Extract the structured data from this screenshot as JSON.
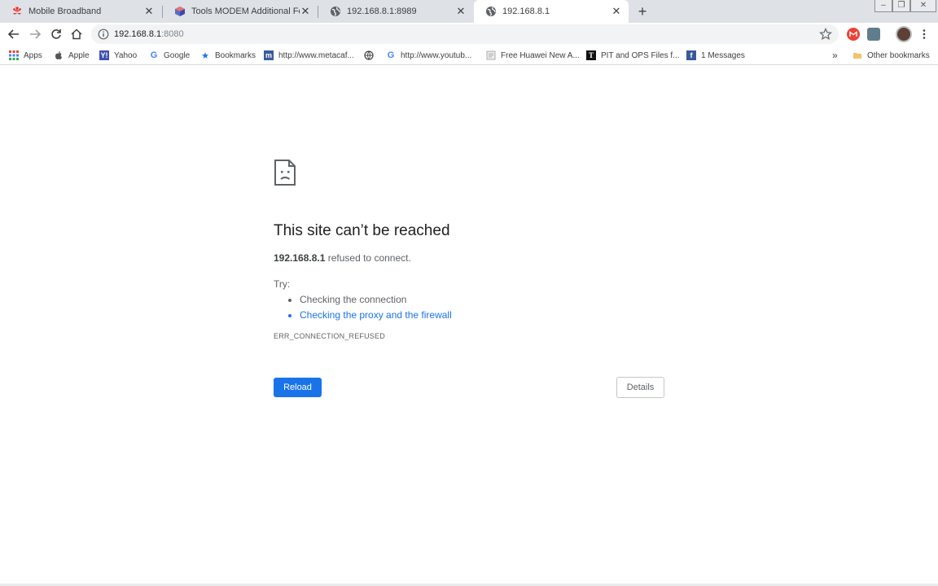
{
  "tabs": [
    {
      "title": "Mobile Broadband",
      "favicon": "huawei-logo-icon"
    },
    {
      "title": "Tools MODEM Additional Featur",
      "favicon": "cube-icon"
    },
    {
      "title": "192.168.8.1:8989",
      "favicon": "globe-icon"
    },
    {
      "title": "192.168.8.1",
      "favicon": "globe-icon",
      "active": true
    }
  ],
  "toolbar": {
    "url_host": "192.168.8.1",
    "url_port": ":8080"
  },
  "bookmarks": [
    {
      "label": "Apps",
      "icon": "apps-grid-icon"
    },
    {
      "label": "Apple",
      "icon": "apple-icon"
    },
    {
      "label": "Yahoo",
      "icon": "yahoo-icon"
    },
    {
      "label": "Google",
      "icon": "google-icon"
    },
    {
      "label": "Bookmarks",
      "icon": "star-icon"
    },
    {
      "label": "http://www.metacaf...",
      "icon": "metacafe-icon"
    },
    {
      "label": "",
      "icon": "web-icon"
    },
    {
      "label": "http://www.youtub...",
      "icon": "google-icon"
    },
    {
      "label": "Free Huawei New A...",
      "icon": "page-icon"
    },
    {
      "label": "PIT and OPS Files f...",
      "icon": "t-logo-icon"
    },
    {
      "label": "1 Messages",
      "icon": "facebook-icon"
    }
  ],
  "bookmarks_more": "»",
  "other_bookmarks": "Other bookmarks",
  "error": {
    "title": "This site can’t be reached",
    "host": "192.168.8.1",
    "message": " refused to connect.",
    "try_label": "Try:",
    "suggestions": [
      "Checking the connection",
      "Checking the proxy and the firewall"
    ],
    "code": "ERR_CONNECTION_REFUSED",
    "reload_label": "Reload",
    "details_label": "Details"
  },
  "colors": {
    "accent": "#1a73e8",
    "tabstrip": "#dee1e6"
  }
}
